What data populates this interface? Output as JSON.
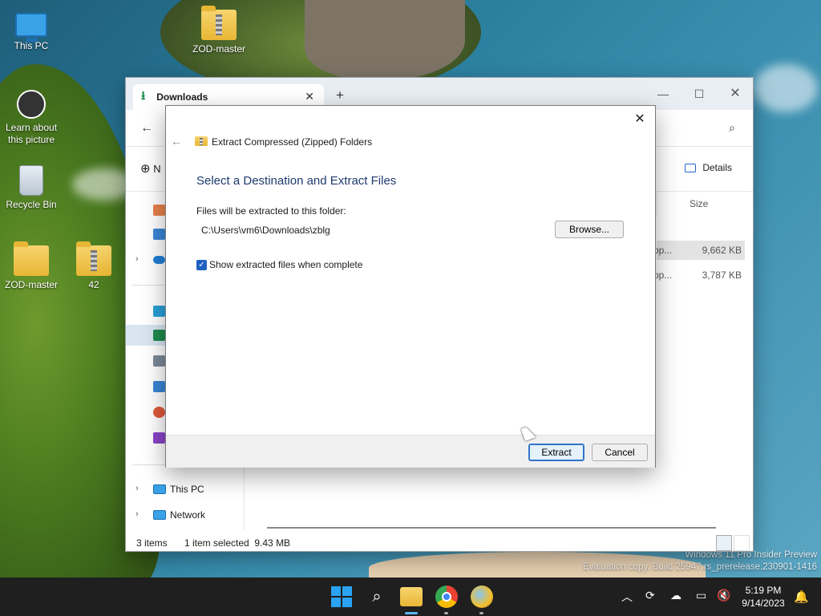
{
  "desktop": {
    "icons": [
      {
        "label": "This PC"
      },
      {
        "label": "ZOD-master"
      },
      {
        "label": "Learn about this picture"
      },
      {
        "label": "Recycle Bin"
      },
      {
        "label": "ZOD-master"
      },
      {
        "label": "42"
      }
    ],
    "watermark_line1": "Windows 11 Pro Insider Preview",
    "watermark_line2": "Evaluation copy. Build 25947.rs_prerelease.230901-1416"
  },
  "explorer": {
    "tab_label": "Downloads",
    "new_tab_glyph": "+",
    "new_label": "N",
    "details_label": "Details",
    "column_size": "Size",
    "files": [
      {
        "name_fragment": "pp...",
        "size": "9,662 KB",
        "selected": true
      },
      {
        "name_fragment": "pp...",
        "size": "3,787 KB",
        "selected": false
      }
    ],
    "nav_this_pc": "This PC",
    "nav_network": "Network",
    "status_items": "3 items",
    "status_selected": "1 item selected  9.43 MB"
  },
  "dialog": {
    "title": "Extract Compressed (Zipped) Folders",
    "heading": "Select a Destination and Extract Files",
    "dest_label": "Files will be extracted to this folder:",
    "dest_path": "C:\\Users\\vm6\\Downloads\\zblg",
    "browse_label": "Browse...",
    "checkbox_label": "Show extracted files when complete",
    "checkbox_checked": true,
    "extract_label": "Extract",
    "cancel_label": "Cancel"
  },
  "taskbar": {
    "time": "5:19 PM",
    "date": "9/14/2023"
  }
}
